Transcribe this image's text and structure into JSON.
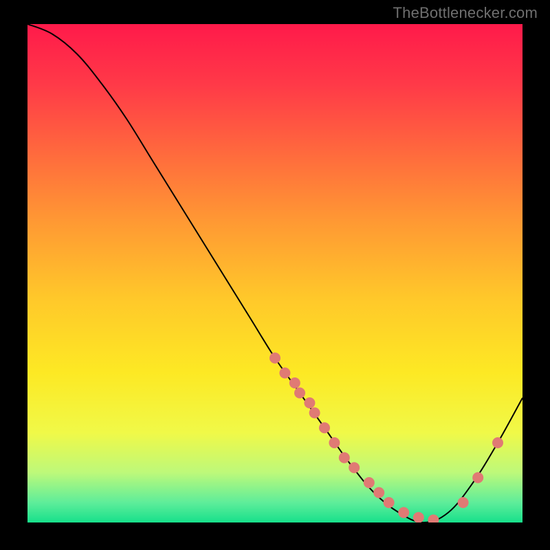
{
  "attribution": "TheBottlenecker.com",
  "chart_data": {
    "type": "line",
    "title": "",
    "xlabel": "",
    "ylabel": "",
    "xlim": [
      0,
      100
    ],
    "ylim": [
      0,
      100
    ],
    "series": [
      {
        "name": "curve",
        "x": [
          0,
          5,
          10,
          15,
          20,
          25,
          30,
          35,
          40,
          45,
          50,
          55,
          60,
          65,
          70,
          75,
          80,
          85,
          90,
          95,
          100
        ],
        "y": [
          100,
          98,
          94,
          88,
          81,
          73,
          65,
          57,
          49,
          41,
          33,
          26,
          19,
          12,
          6,
          2,
          0,
          2,
          8,
          16,
          25
        ]
      }
    ],
    "markers": {
      "name": "dots",
      "x": [
        50,
        52,
        54,
        55,
        57,
        58,
        60,
        62,
        64,
        66,
        69,
        71,
        73,
        76,
        79,
        82,
        88,
        91,
        95
      ],
      "y": [
        33,
        30,
        28,
        26,
        24,
        22,
        19,
        16,
        13,
        11,
        8,
        6,
        4,
        2,
        1,
        0.5,
        4,
        9,
        16
      ]
    },
    "gradient_stops": [
      {
        "offset": 0.0,
        "color": "#ff1a4a"
      },
      {
        "offset": 0.12,
        "color": "#ff3948"
      },
      {
        "offset": 0.26,
        "color": "#ff6a3d"
      },
      {
        "offset": 0.4,
        "color": "#ff9a33"
      },
      {
        "offset": 0.55,
        "color": "#ffc82a"
      },
      {
        "offset": 0.7,
        "color": "#fde924"
      },
      {
        "offset": 0.82,
        "color": "#f0f948"
      },
      {
        "offset": 0.9,
        "color": "#bdf97a"
      },
      {
        "offset": 0.96,
        "color": "#5eed9a"
      },
      {
        "offset": 1.0,
        "color": "#17e08b"
      }
    ],
    "marker_color": "#e07a74",
    "curve_color": "#000000"
  }
}
